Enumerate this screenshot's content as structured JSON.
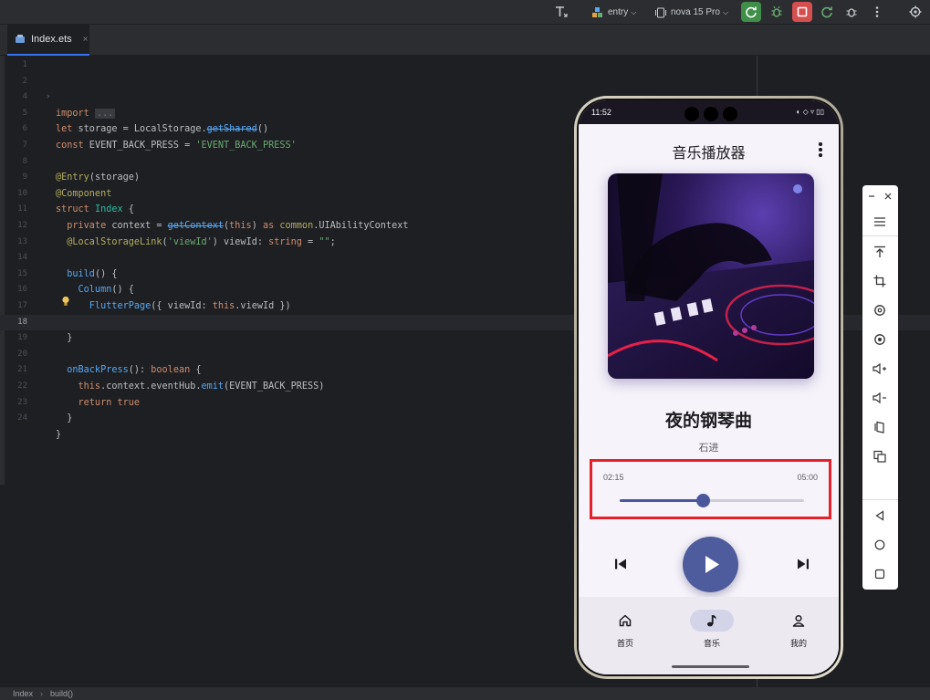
{
  "toolbar": {
    "module": "entry",
    "device": "nova 15 Pro"
  },
  "tab": {
    "filename": "Index.ets",
    "close": "×"
  },
  "editor": {
    "current_line": 18,
    "lines": [
      {
        "n": "1"
      },
      {
        "n": "2"
      },
      {
        "n": "4"
      },
      {
        "n": "5"
      },
      {
        "n": "6"
      },
      {
        "n": "7"
      },
      {
        "n": "8"
      },
      {
        "n": "9"
      },
      {
        "n": "10"
      },
      {
        "n": "11"
      },
      {
        "n": "12"
      },
      {
        "n": "13"
      },
      {
        "n": "14"
      },
      {
        "n": "15"
      },
      {
        "n": "16"
      },
      {
        "n": "17"
      },
      {
        "n": "18"
      },
      {
        "n": "19"
      },
      {
        "n": "20"
      },
      {
        "n": "21"
      },
      {
        "n": "22"
      },
      {
        "n": "23"
      },
      {
        "n": "24"
      }
    ],
    "code": {
      "l2_kw": "import",
      "l2_fold": "...",
      "l5_kw": "let",
      "l5_a": " storage = LocalStorage.",
      "l5_dep": "getShared",
      "l5_b": "()",
      "l6_kw": "const",
      "l6_a": " EVENT_BACK_PRESS = ",
      "l6_str": "'EVENT_BACK_PRESS'",
      "l8_ann": "@Entry",
      "l8_a": "(storage)",
      "l9_ann": "@Component",
      "l10_kw": "struct",
      "l10_typ": " Index",
      "l10_a": " {",
      "l11_kw": "  private",
      "l11_a": " context = ",
      "l11_dep": "getContext",
      "l11_b": "(",
      "l11_kw2": "this",
      "l11_c": ") ",
      "l11_kw3": "as",
      "l11_typ": " common",
      "l11_d": ".UIAbilityContext",
      "l12_ann": "  @LocalStorageLink",
      "l12_a": "(",
      "l12_str": "'viewId'",
      "l12_b": ") viewId: ",
      "l12_kw": "string",
      "l12_c": " = ",
      "l12_str2": "\"\"",
      "l12_d": ";",
      "l14_fn": "  build",
      "l14_a": "() {",
      "l15_fn": "    Column",
      "l15_a": "() {",
      "l16_fn": "      FlutterPage",
      "l16_a": "({ viewId: ",
      "l16_kw": "this",
      "l16_b": ".viewId })",
      "l17_a": "    }",
      "l18_a": "  }",
      "l20_fn": "  onBackPress",
      "l20_a": "(): ",
      "l20_kw": "boolean",
      "l20_b": " {",
      "l21_kw": "    this",
      "l21_a": ".context.eventHub.",
      "l21_fn": "emit",
      "l21_b": "(EVENT_BACK_PRESS)",
      "l22_kw": "    return",
      "l22_kw2": " true",
      "l23_a": "  }",
      "l24_a": "}"
    }
  },
  "statusbar": {
    "crumb1": "Index",
    "crumb2": "build()"
  },
  "phone": {
    "status_time": "11:52",
    "status_icons": "◐ ◇ ▿ ▯▯",
    "app_title": "音乐播放器",
    "song_title": "夜的钢琴曲",
    "artist": "石进",
    "time_current": "02:15",
    "time_total": "05:00",
    "progress": 0.45,
    "nav": [
      {
        "label": "首页",
        "icon": "home-icon"
      },
      {
        "label": "音乐",
        "icon": "music-note-icon",
        "active": true
      },
      {
        "label": "我的",
        "icon": "person-icon"
      }
    ]
  },
  "colors": {
    "accent": "#4e5b9c",
    "highlight_border": "#e4202a",
    "ide_bg": "#1e1f22"
  }
}
